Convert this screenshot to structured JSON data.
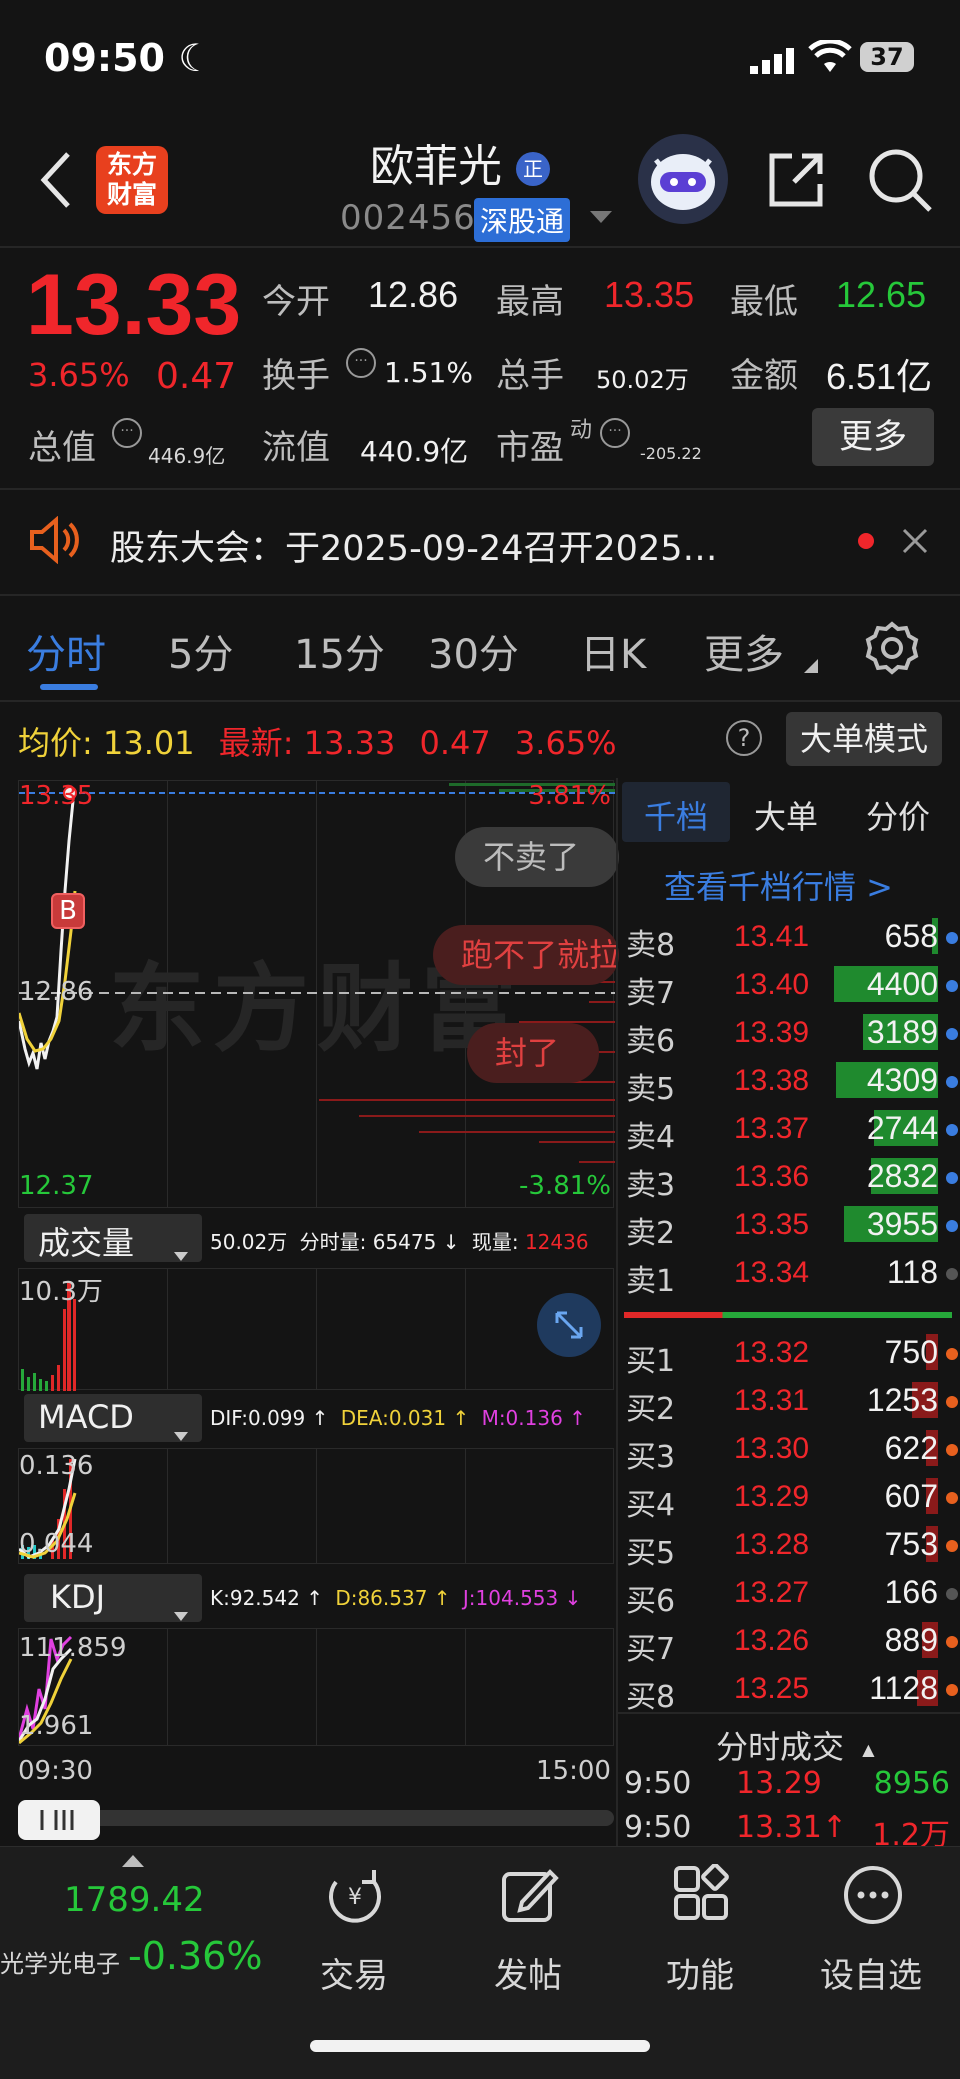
{
  "status": {
    "time": "09:50",
    "battery": "37"
  },
  "header": {
    "title": "欧菲光",
    "title_badge": "正",
    "code": "002456",
    "market_tag": "深股通",
    "logo_line1": "东方",
    "logo_line2": "财富"
  },
  "quote": {
    "price": "13.33",
    "change_pct": "3.65%",
    "change": "0.47",
    "open_label": "今开",
    "open": "12.86",
    "high_label": "最高",
    "high": "13.35",
    "low_label": "最低",
    "low": "12.65",
    "turnover_label": "换手",
    "turnover": "1.51%",
    "volume_label": "总手",
    "volume": "50.02万",
    "amount_label": "金额",
    "amount": "6.51亿",
    "mktcap_label": "总值",
    "mktcap": "446.9亿",
    "float_label": "流值",
    "float": "440.9亿",
    "pe_label": "市盈",
    "pe_sup": "动",
    "pe": "-205.22",
    "more": "更多"
  },
  "notice": {
    "text": "股东大会：于2025-09-24召开2025…"
  },
  "tabs": [
    "分时",
    "5分",
    "15分",
    "30分",
    "日K",
    "更多"
  ],
  "price_row": {
    "avg_label": "均价:",
    "avg": "13.01",
    "last_label": "最新:",
    "last": "13.33",
    "chg": "0.47",
    "pct": "3.65%",
    "help": "?",
    "mode_btn": "大单模式"
  },
  "chart": {
    "top_price": "13.35",
    "top_pct": "3.81%",
    "mid_price": "12.86",
    "bot_price": "12.37",
    "bot_pct": "-3.81%",
    "watermark": "东方财富",
    "bubbles": [
      "不卖了",
      "跑不了就拉",
      "封了"
    ],
    "b_marker": "B",
    "time_start": "09:30",
    "time_end": "15:00"
  },
  "volume_panel": {
    "selector": "成交量",
    "info_total": "50.02万",
    "info_minute_label": "分时量:",
    "info_minute": "65475 ↓",
    "info_now_label": "现量:",
    "info_now": "12436",
    "max": "10.3万"
  },
  "macd_panel": {
    "selector": "MACD",
    "dif": "DIF:0.099 ↑",
    "dea": "DEA:0.031 ↑",
    "m": "M:0.136 ↑",
    "top": "0.136",
    "bottom": "0.044"
  },
  "kdj_panel": {
    "selector": "KDJ",
    "k": "K:92.542 ↑",
    "d": "D:86.537 ↑",
    "j": "J:104.553 ↓",
    "top": "111.859",
    "bottom": "1.961"
  },
  "orderbook": {
    "tabs": [
      "千档",
      "大单",
      "分价"
    ],
    "link": "查看千档行情 >",
    "asks": [
      {
        "label": "卖8",
        "price": "13.41",
        "vol": "658",
        "fill": 0.06
      },
      {
        "label": "卖7",
        "price": "13.40",
        "vol": "4400",
        "fill": 1.0
      },
      {
        "label": "卖6",
        "price": "13.39",
        "vol": "3189",
        "fill": 0.72
      },
      {
        "label": "卖5",
        "price": "13.38",
        "vol": "4309",
        "fill": 0.98
      },
      {
        "label": "卖4",
        "price": "13.37",
        "vol": "2744",
        "fill": 0.62
      },
      {
        "label": "卖3",
        "price": "13.36",
        "vol": "2832",
        "fill": 0.64
      },
      {
        "label": "卖2",
        "price": "13.35",
        "vol": "3955",
        "fill": 0.9
      },
      {
        "label": "卖1",
        "price": "13.34",
        "vol": "118",
        "fill": 0.0
      }
    ],
    "bids": [
      {
        "label": "买1",
        "price": "13.32",
        "vol": "750",
        "fill": 0.12
      },
      {
        "label": "买2",
        "price": "13.31",
        "vol": "1253",
        "fill": 0.25
      },
      {
        "label": "买3",
        "price": "13.30",
        "vol": "622",
        "fill": 0.12
      },
      {
        "label": "买4",
        "price": "13.29",
        "vol": "607",
        "fill": 0.12
      },
      {
        "label": "买5",
        "price": "13.28",
        "vol": "753",
        "fill": 0.12
      },
      {
        "label": "买6",
        "price": "13.27",
        "vol": "166",
        "fill": 0.0
      },
      {
        "label": "买7",
        "price": "13.26",
        "vol": "889",
        "fill": 0.15
      },
      {
        "label": "买8",
        "price": "13.25",
        "vol": "1128",
        "fill": 0.2
      }
    ],
    "trades_title": "分时成交",
    "trades": [
      {
        "time": "9:50",
        "price": "13.29",
        "vol": "8956"
      },
      {
        "time": "9:50",
        "price": "13.31↑",
        "vol": "1.2万"
      }
    ]
  },
  "bottom": {
    "index_value": "1789.42",
    "index_name": "光学光电子",
    "index_pct": "-0.36%",
    "nav": [
      "交易",
      "发帖",
      "功能",
      "设自选"
    ]
  },
  "colors": {
    "up": "#f0262b",
    "down": "#26c83a",
    "accent": "#3a7de0",
    "avg_line": "#f0d23a"
  }
}
